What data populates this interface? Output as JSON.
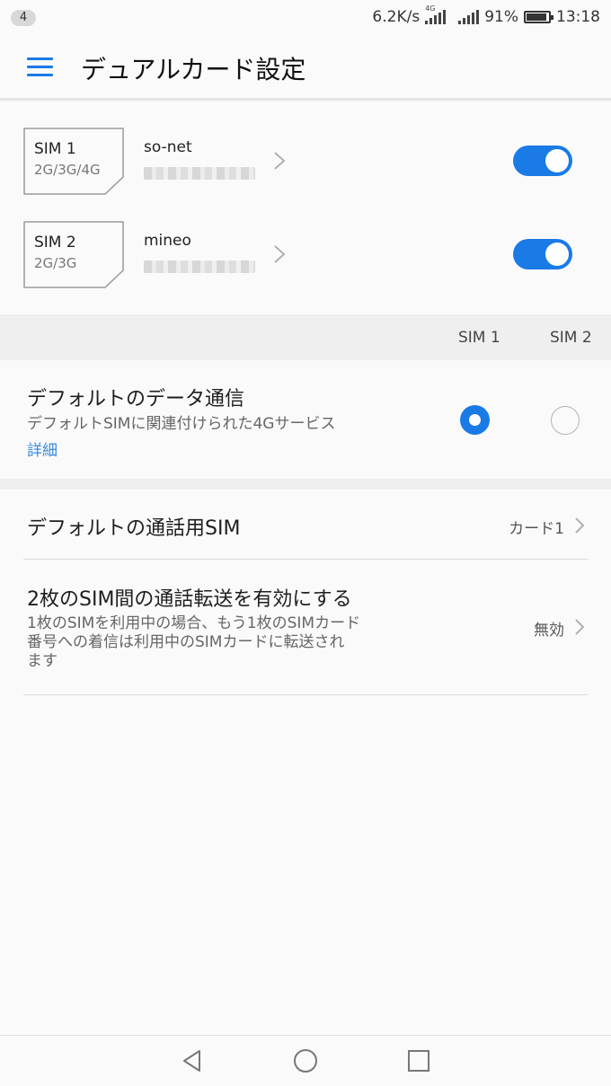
{
  "status_bar": {
    "notification_count": "4",
    "speed": "6.2K/s",
    "net_type": "4G",
    "battery": "91%",
    "time": "13:18"
  },
  "header": {
    "title": "デュアルカード設定"
  },
  "sims": [
    {
      "slot": "SIM 1",
      "network": "2G/3G/4G",
      "carrier": "so-net",
      "enabled": true
    },
    {
      "slot": "SIM 2",
      "network": "2G/3G",
      "carrier": "mineo",
      "enabled": true
    }
  ],
  "columns": {
    "sim1": "SIM 1",
    "sim2": "SIM 2"
  },
  "default_data": {
    "title": "デフォルトのデータ通信",
    "subtitle": "デフォルトSIMに関連付けられた4Gサービス",
    "detail_link": "詳細",
    "selected": "SIM 1"
  },
  "default_call": {
    "title": "デフォルトの通話用SIM",
    "value": "カード1"
  },
  "call_forward": {
    "title": "2枚のSIM間の通話転送を有効にする",
    "subtitle_lines": [
      "1枚のSIMを利用中の場合、もう1枚のSIMカード",
      "番号への着信は利用中のSIMカードに転送され",
      "ます"
    ],
    "value": "無効"
  },
  "colors": {
    "accent": "#1a7ae6",
    "link": "#3a8ae0",
    "band": "#efefef",
    "background": "#fafafa"
  }
}
